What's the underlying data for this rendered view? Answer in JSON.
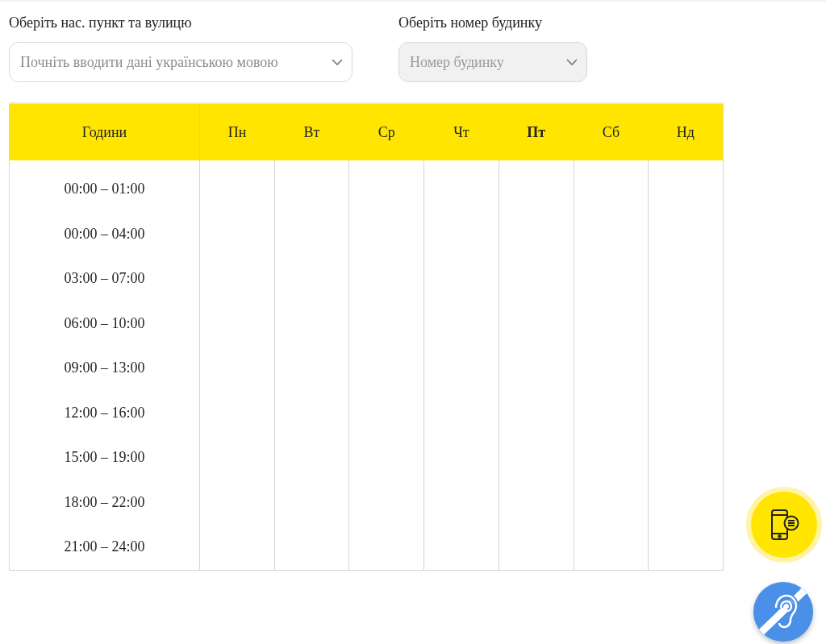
{
  "street_select": {
    "label": "Оберіть нас. пункт та вулицю",
    "placeholder": "Почніть вводити дані українською мовою",
    "disabled": false
  },
  "house_select": {
    "label": "Оберіть номер будинку",
    "placeholder": "Номер будинку",
    "disabled": true
  },
  "table": {
    "hours_heading": "Години",
    "days": [
      {
        "label": "Пн",
        "selected": false
      },
      {
        "label": "Вт",
        "selected": false
      },
      {
        "label": "Ср",
        "selected": false
      },
      {
        "label": "Чт",
        "selected": false
      },
      {
        "label": "Пт",
        "selected": true
      },
      {
        "label": "Сб",
        "selected": false
      },
      {
        "label": "Нд",
        "selected": false
      }
    ],
    "rows": [
      "00:00 – 01:00",
      "00:00 – 04:00",
      "03:00 – 07:00",
      "06:00 – 10:00",
      "09:00 – 13:00",
      "12:00 – 16:00",
      "15:00 – 19:00",
      "18:00 – 22:00",
      "21:00 – 24:00"
    ]
  }
}
